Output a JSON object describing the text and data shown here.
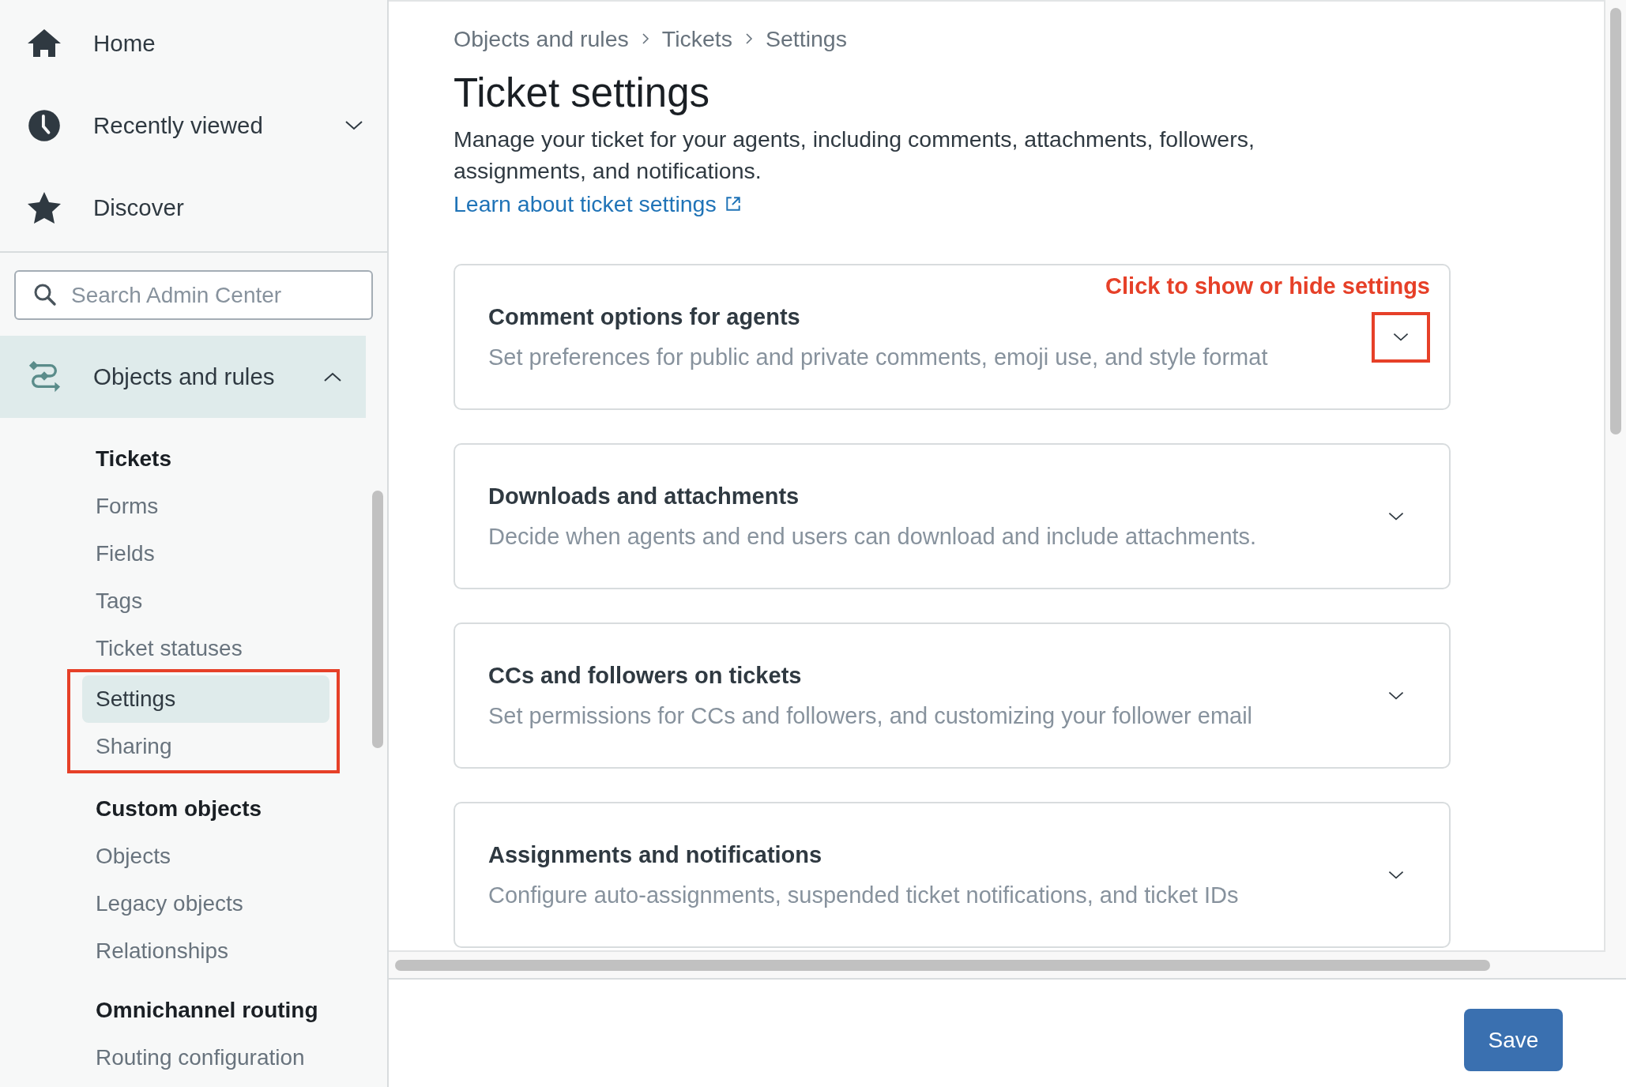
{
  "sidebar": {
    "nav_items": [
      {
        "label": "Home"
      },
      {
        "label": "Recently viewed",
        "expanded": false
      },
      {
        "label": "Discover"
      }
    ],
    "search": {
      "placeholder": "Search Admin Center"
    },
    "section": {
      "label": "Objects and rules",
      "expanded": true,
      "selected": true
    },
    "groups": [
      {
        "heading": "Tickets",
        "items": [
          {
            "label": "Forms",
            "selected": false,
            "framed": false
          },
          {
            "label": "Fields",
            "selected": false,
            "framed": false
          },
          {
            "label": "Tags",
            "selected": false,
            "framed": false
          },
          {
            "label": "Ticket statuses",
            "selected": false,
            "framed": false
          },
          {
            "label": "Settings",
            "selected": true,
            "framed": true
          },
          {
            "label": "Sharing",
            "selected": false,
            "framed": true
          }
        ]
      },
      {
        "heading": "Custom objects",
        "items": [
          {
            "label": "Objects",
            "selected": false,
            "framed": false
          },
          {
            "label": "Legacy objects",
            "selected": false,
            "framed": false
          },
          {
            "label": "Relationships",
            "selected": false,
            "framed": false
          }
        ]
      },
      {
        "heading": "Omnichannel routing",
        "items": [
          {
            "label": "Routing configuration",
            "selected": false,
            "framed": false
          }
        ]
      }
    ]
  },
  "breadcrumb": [
    "Objects and rules",
    "Tickets",
    "Settings"
  ],
  "page": {
    "title": "Ticket settings",
    "description": "Manage your ticket for your agents, including comments, attachments, followers, assignments, and notifications.",
    "link": "Learn about ticket settings"
  },
  "cards": [
    {
      "title": "Comment options for agents",
      "description": "Set preferences for public and private comments, emoji use, and style format",
      "expanded": false,
      "callout": "Click to show or hide settings",
      "framed": true
    },
    {
      "title": "Downloads and attachments",
      "description": "Decide when agents and end users can download and include attachments.",
      "expanded": false,
      "framed": false
    },
    {
      "title": "CCs and followers on tickets",
      "description": "Set permissions for CCs and followers, and customizing your follower email",
      "expanded": false,
      "framed": false
    },
    {
      "title": "Assignments and notifications",
      "description": "Configure auto-assignments, suspended ticket notifications, and ticket IDs",
      "expanded": false,
      "framed": false
    }
  ],
  "footer": {
    "button": "Save"
  }
}
